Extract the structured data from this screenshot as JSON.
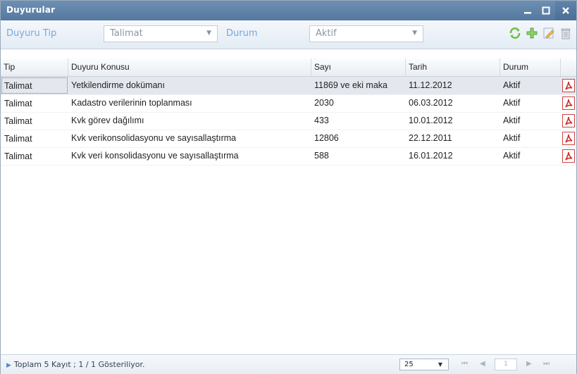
{
  "window": {
    "title": "Duyurular",
    "minimize": "—",
    "maximize": "□",
    "close": "✕"
  },
  "toolbar": {
    "type_label": "Duyuru Tip",
    "type_value": "Talimat",
    "status_label": "Durum",
    "status_value": "Aktif",
    "tool_icons": [
      "refresh-icon",
      "add-icon",
      "edit-icon",
      "delete-icon"
    ]
  },
  "columns": [
    "Tip",
    "Duyuru Konusu",
    "Sayı",
    "Tarih",
    "Durum"
  ],
  "rows": [
    {
      "tip": "Talimat",
      "konu": "Yetkilendirme dokümanı",
      "sayi": "11869 ve eki maka",
      "tarih": "11.12.2012",
      "durum": "Aktif"
    },
    {
      "tip": "Talimat",
      "konu": "Kadastro verilerinin toplanması",
      "sayi": "2030",
      "tarih": "06.03.2012",
      "durum": "Aktif"
    },
    {
      "tip": "Talimat",
      "konu": "Kvk görev dağılımı",
      "sayi": "433",
      "tarih": "10.01.2012",
      "durum": "Aktif"
    },
    {
      "tip": "Talimat",
      "konu": "Kvk verikonsolidasyonu ve sayısallaştırma",
      "sayi": "12806",
      "tarih": "22.12.2011",
      "durum": "Aktif"
    },
    {
      "tip": "Talimat",
      "konu": "Kvk veri konsolidasyonu ve sayısallaştırma",
      "sayi": "588",
      "tarih": "16.01.2012",
      "durum": "Aktif"
    }
  ],
  "footer": {
    "summary": "Toplam 5 Kayıt ; 1 / 1 Gösteriliyor.",
    "page_size": "25",
    "page_number": "1",
    "nav_first": "⏮",
    "nav_prev": "◀",
    "nav_next": "▶",
    "nav_last": "⏭"
  },
  "colors": {
    "titlebar": "#5f82a8",
    "selected_row": "#e4e8ee",
    "label": "#7aa6d6"
  }
}
